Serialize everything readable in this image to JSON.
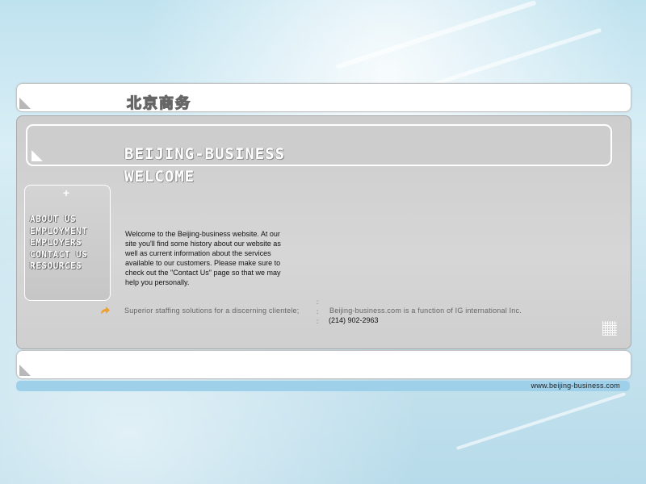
{
  "header": {
    "logo_cn": "北京商务"
  },
  "main": {
    "title_line1": "BEIJING-BUSINESS",
    "title_line2": "WELCOME",
    "nav": {
      "plus_icon": "+",
      "items": [
        {
          "label": "ABOUT US"
        },
        {
          "label": "EMPLOYMENT"
        },
        {
          "label": "EMPLOYERS"
        },
        {
          "label": "CONTACT US"
        },
        {
          "label": "RESOURCES"
        }
      ]
    },
    "welcome_text": "Welcome to the Beijing-business website. At our site you'll find some history about our website as well as current information about the services available to our customers. Please make sure to check out the \"Contact Us\" page so that we may help you personally.",
    "tagline": "Superior staffing solutions for a discerning clientele;",
    "company_line": "Beijing-business.com is a function of IG international Inc.",
    "phone": "(214) 902-2963",
    "separator": ":"
  },
  "footer": {
    "url": "www.beijing-business.com"
  },
  "colors": {
    "footer_strip": "#9fd0ea",
    "arrow_icon": "#f0a030"
  },
  "icons": {
    "arrow": "orange-curved-arrow-icon",
    "grid": "grid-icon",
    "corner": "corner-triangle-icon"
  }
}
